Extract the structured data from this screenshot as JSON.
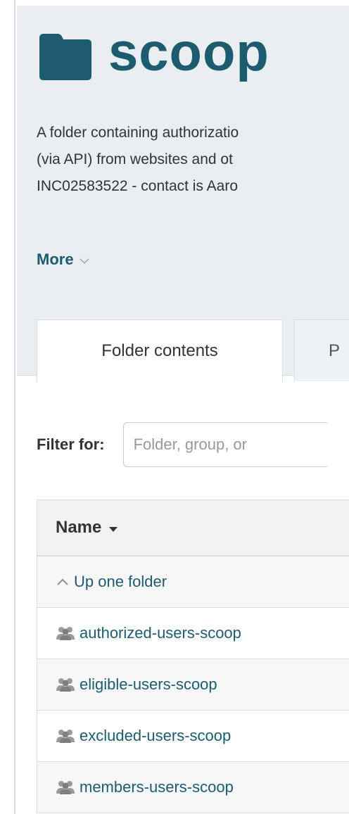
{
  "folder": {
    "title": "scoop",
    "description_lines": [
      "A folder containing authorizatio",
      "(via API) from websites and ot",
      "INC02583522 - contact is Aaro"
    ],
    "more_label": "More"
  },
  "tabs": [
    {
      "label": "Folder contents",
      "active": true
    },
    {
      "label": "P",
      "active": false
    }
  ],
  "filter": {
    "label": "Filter for:",
    "placeholder": "Folder, group, or"
  },
  "table": {
    "header": "Name",
    "rows": [
      {
        "label": "Up one folder",
        "icon": "chevron-up-icon"
      },
      {
        "label": "authorized-users-scoop",
        "icon": "group-icon"
      },
      {
        "label": "eligible-users-scoop",
        "icon": "group-icon"
      },
      {
        "label": "excluded-users-scoop",
        "icon": "group-icon"
      },
      {
        "label": "members-users-scoop",
        "icon": "group-icon"
      }
    ]
  },
  "colors": {
    "brand": "#1d5b6e",
    "header_bg": "#e9eef1"
  }
}
